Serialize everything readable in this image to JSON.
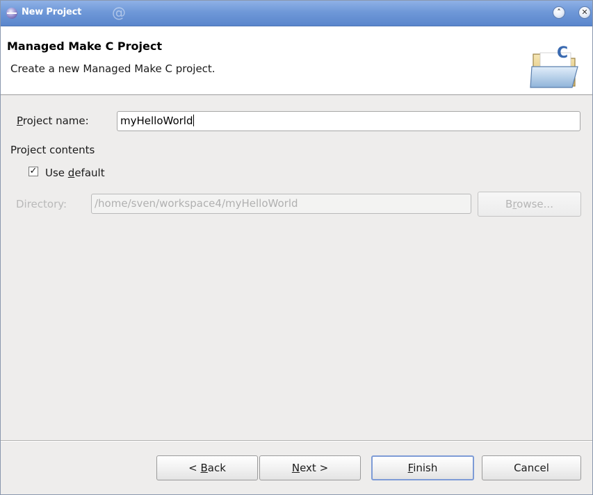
{
  "window": {
    "title": "New Project",
    "minimize_icon": "collapse-icon",
    "close_icon": "close-icon"
  },
  "header": {
    "title": "Managed Make C Project",
    "description": "Create a new Managed Make C project.",
    "icon": "c-folder-wizard-icon"
  },
  "form": {
    "project_name": {
      "mnemonic": "P",
      "label_rest": "roject name:",
      "value": "myHelloWorld"
    },
    "project_contents_label": "Project contents",
    "use_default": {
      "checked": true,
      "label_prefix": "Use ",
      "mnemonic": "d",
      "label_rest": "efault"
    },
    "directory": {
      "label": "Directory:",
      "value": "/home/sven/workspace4/myHelloWorld",
      "enabled": false
    },
    "browse_button": {
      "prefix": "B",
      "mnemonic": "r",
      "rest": "owse..."
    }
  },
  "footer": {
    "back": {
      "prefix": "< ",
      "mnemonic": "B",
      "rest": "ack"
    },
    "next": {
      "mnemonic": "N",
      "rest": "ext >"
    },
    "finish": {
      "mnemonic": "F",
      "rest": "inish"
    },
    "cancel": {
      "label": "Cancel"
    }
  },
  "colors": {
    "titlebar": "#6f98d8",
    "focus_border": "#7d9bd6",
    "disabled_text": "#b0b0b0"
  }
}
